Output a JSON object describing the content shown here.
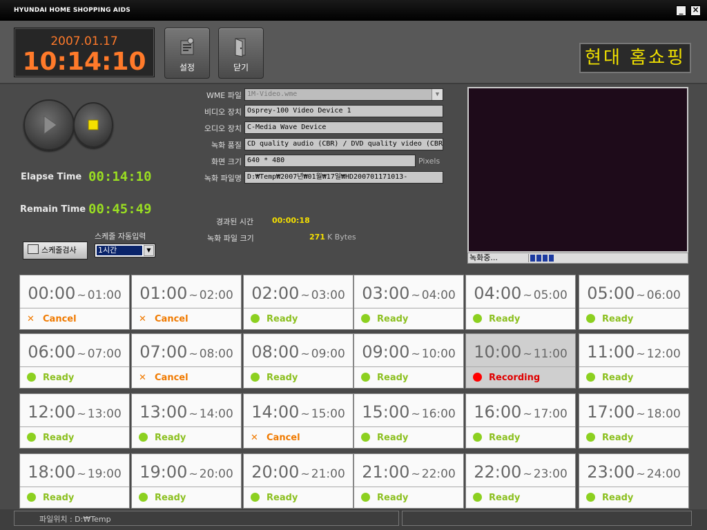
{
  "window": {
    "title": "HYUNDAI HOME SHOPPING AIDS",
    "minimize": "_",
    "close": "×"
  },
  "clock": {
    "date": "2007.01.17",
    "time": "10:14:10"
  },
  "toolbar": {
    "settings_label": "설정",
    "close_label": "닫기"
  },
  "brand": "현대 홈쇼핑",
  "timers": {
    "elapse_label": "Elapse Time",
    "elapse_value": "00:14:10",
    "remain_label": "Remain Time",
    "remain_value": "00:45:49"
  },
  "form": {
    "wme_label": "WME 파일",
    "wme_value": "1M-Video.wme",
    "video_label": "비디오 장치",
    "video_value": "Osprey-100 Video Device 1",
    "audio_label": "오디오 장치",
    "audio_value": "C-Media Wave Device",
    "quality_label": "녹화 품질",
    "quality_value": "CD quality audio (CBR) / DVD quality video (CBR",
    "size_label": "화면 크기",
    "size_value": "640 * 480",
    "size_unit": "Pixels",
    "file_label": "녹화 파일명",
    "file_value": "D:₩Temp₩2007년₩01월₩17일₩HD200701171013-"
  },
  "progress": {
    "elapsed_label": "경과된 시간",
    "elapsed_value": "00:00:18",
    "filesize_label": "녹화 파일 크기",
    "filesize_value": "271",
    "filesize_unit": "K Bytes"
  },
  "preview": {
    "status_text": "녹화중...",
    "level_blocks": 4
  },
  "schedule": {
    "check_button": "스케줄검사",
    "auto_label": "스케줄 자동입력",
    "auto_value": "1시간"
  },
  "colors": {
    "ready": "#8cd020",
    "cancel": "#f07a00",
    "recording": "#ff0000"
  },
  "slots": [
    {
      "start": "00:00",
      "end": "01:00",
      "status": "Cancel"
    },
    {
      "start": "01:00",
      "end": "02:00",
      "status": "Cancel"
    },
    {
      "start": "02:00",
      "end": "03:00",
      "status": "Ready"
    },
    {
      "start": "03:00",
      "end": "04:00",
      "status": "Ready"
    },
    {
      "start": "04:00",
      "end": "05:00",
      "status": "Ready"
    },
    {
      "start": "05:00",
      "end": "06:00",
      "status": "Ready"
    },
    {
      "start": "06:00",
      "end": "07:00",
      "status": "Ready"
    },
    {
      "start": "07:00",
      "end": "08:00",
      "status": "Cancel"
    },
    {
      "start": "08:00",
      "end": "09:00",
      "status": "Ready"
    },
    {
      "start": "09:00",
      "end": "10:00",
      "status": "Ready"
    },
    {
      "start": "10:00",
      "end": "11:00",
      "status": "Recording"
    },
    {
      "start": "11:00",
      "end": "12:00",
      "status": "Ready"
    },
    {
      "start": "12:00",
      "end": "13:00",
      "status": "Ready"
    },
    {
      "start": "13:00",
      "end": "14:00",
      "status": "Ready"
    },
    {
      "start": "14:00",
      "end": "15:00",
      "status": "Cancel"
    },
    {
      "start": "15:00",
      "end": "16:00",
      "status": "Ready"
    },
    {
      "start": "16:00",
      "end": "17:00",
      "status": "Ready"
    },
    {
      "start": "17:00",
      "end": "18:00",
      "status": "Ready"
    },
    {
      "start": "18:00",
      "end": "19:00",
      "status": "Ready"
    },
    {
      "start": "19:00",
      "end": "20:00",
      "status": "Ready"
    },
    {
      "start": "20:00",
      "end": "21:00",
      "status": "Ready"
    },
    {
      "start": "21:00",
      "end": "22:00",
      "status": "Ready"
    },
    {
      "start": "22:00",
      "end": "23:00",
      "status": "Ready"
    },
    {
      "start": "23:00",
      "end": "24:00",
      "status": "Ready"
    }
  ],
  "footer": {
    "location": "파일위치 : D:₩Temp"
  }
}
